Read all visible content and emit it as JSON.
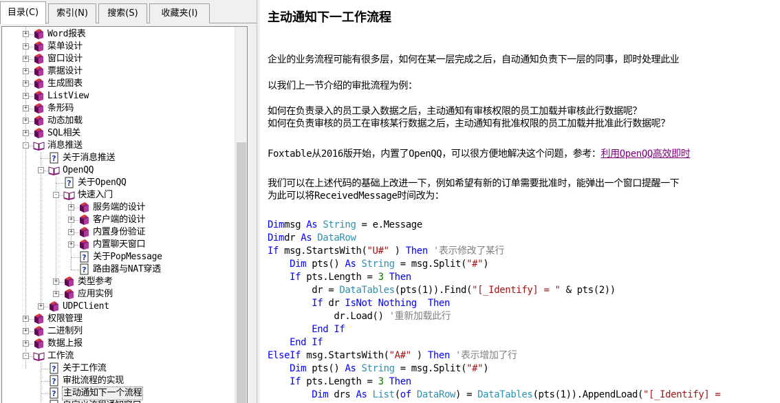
{
  "tabs": [
    "目录(C)",
    "索引(N)",
    "搜索(S)",
    "收藏夹(I)"
  ],
  "tree": [
    {
      "label": "Word报表",
      "depth": 0,
      "type": "book",
      "exp": "+"
    },
    {
      "label": "菜单设计",
      "depth": 0,
      "type": "book",
      "exp": "+"
    },
    {
      "label": "窗口设计",
      "depth": 0,
      "type": "book",
      "exp": "+"
    },
    {
      "label": "票据设计",
      "depth": 0,
      "type": "book",
      "exp": "+"
    },
    {
      "label": "生成图表",
      "depth": 0,
      "type": "book",
      "exp": "+"
    },
    {
      "label": "ListView",
      "depth": 0,
      "type": "book",
      "exp": "+"
    },
    {
      "label": "条形码",
      "depth": 0,
      "type": "book",
      "exp": "+"
    },
    {
      "label": "动态加载",
      "depth": 0,
      "type": "book",
      "exp": "+"
    },
    {
      "label": "SQL相关",
      "depth": 0,
      "type": "book",
      "exp": "+"
    },
    {
      "label": "消息推送",
      "depth": 0,
      "type": "open",
      "exp": "-"
    },
    {
      "label": "关于消息推送",
      "depth": 1,
      "type": "page",
      "exp": ""
    },
    {
      "label": "OpenQQ",
      "depth": 1,
      "type": "open",
      "exp": "-"
    },
    {
      "label": "关于OpenQQ",
      "depth": 2,
      "type": "page",
      "exp": ""
    },
    {
      "label": "快速入门",
      "depth": 2,
      "type": "open",
      "exp": "-"
    },
    {
      "label": "服务端的设计",
      "depth": 3,
      "type": "book",
      "exp": "+"
    },
    {
      "label": "客户端的设计",
      "depth": 3,
      "type": "book",
      "exp": "+"
    },
    {
      "label": "内置身份验证",
      "depth": 3,
      "type": "book",
      "exp": "+"
    },
    {
      "label": "内置聊天窗口",
      "depth": 3,
      "type": "book",
      "exp": "+"
    },
    {
      "label": "关于PopMessage",
      "depth": 3,
      "type": "page",
      "exp": ""
    },
    {
      "label": "路由器与NAT穿透",
      "depth": 3,
      "type": "page",
      "exp": ""
    },
    {
      "label": "类型参考",
      "depth": 2,
      "type": "book",
      "exp": "+"
    },
    {
      "label": "应用实例",
      "depth": 2,
      "type": "book",
      "exp": "+"
    },
    {
      "label": "UDPClient",
      "depth": 1,
      "type": "book",
      "exp": "+"
    },
    {
      "label": "权限管理",
      "depth": 0,
      "type": "book",
      "exp": "+"
    },
    {
      "label": "二进制列",
      "depth": 0,
      "type": "book",
      "exp": "+"
    },
    {
      "label": "数据上报",
      "depth": 0,
      "type": "book",
      "exp": "+"
    },
    {
      "label": "工作流",
      "depth": 0,
      "type": "open",
      "exp": "-"
    },
    {
      "label": "关于工作流",
      "depth": 1,
      "type": "page",
      "exp": ""
    },
    {
      "label": "审批流程的实现",
      "depth": 1,
      "type": "page",
      "exp": ""
    },
    {
      "label": "主动通知下一个流程",
      "depth": 1,
      "type": "page",
      "exp": "",
      "selected": true
    },
    {
      "label": "自定义流程通知窗口",
      "depth": 1,
      "type": "page",
      "exp": ""
    }
  ],
  "content": {
    "title": "主动通知下一工作流程",
    "p1": "企业的业务流程可能有很多层，如何在某一层完成之后，自动通知负责下一层的同事，即时处理此业",
    "p2": "以我们上一节介绍的审批流程为例：",
    "p3a": "如何在负责录入的员工录入数据之后，主动通知有审核权限的员工加载并审核此行数据呢？",
    "p3b": "如何在负责审核的员工在审核某行数据之后，主动通知有批准权限的员工加载并批准此行数据呢？",
    "p4": "Foxtable从2016版开始，内置了OpenQQ，可以很方便地解决这个问题，参考：",
    "p4link": "利用OpenQQ高效即时",
    "p5a": "我们可以在上述代码的基础上改进一下，例如希望有新的订单需要批准时，能弹出一个窗口提醒一下",
    "p5b": "为此可以将ReceivedMessage时间改为："
  },
  "code": [
    [
      [
        "kw",
        "Dim"
      ],
      [
        "",
        "msg "
      ],
      [
        "kw",
        "As "
      ],
      [
        "ty",
        "String"
      ],
      [
        "",
        " = e.Message"
      ]
    ],
    [
      [
        "kw",
        "Dim"
      ],
      [
        "",
        "dr "
      ],
      [
        "kw",
        "As "
      ],
      [
        "ty",
        "DataRow"
      ]
    ],
    [
      [
        "kw",
        "If "
      ],
      [
        "",
        "msg.StartsWith("
      ],
      [
        "str",
        "\"U#\""
      ],
      [
        "",
        " ) "
      ],
      [
        "kw",
        "Then "
      ],
      [
        "cm",
        "'表示修改了某行"
      ]
    ],
    [
      [
        "",
        "    "
      ],
      [
        "kw",
        "Dim "
      ],
      [
        "",
        "pts() "
      ],
      [
        "kw",
        "As "
      ],
      [
        "ty",
        "String"
      ],
      [
        "",
        " = msg.Split("
      ],
      [
        "str",
        "\"#\""
      ],
      [
        "",
        ")"
      ]
    ],
    [
      [
        "",
        "    "
      ],
      [
        "kw",
        "If "
      ],
      [
        "",
        "pts.Length = "
      ],
      [
        "num",
        "3 "
      ],
      [
        "kw",
        "Then"
      ]
    ],
    [
      [
        "",
        "        dr = "
      ],
      [
        "ty",
        "DataTables"
      ],
      [
        "",
        "(pts(1)).Find("
      ],
      [
        "str",
        "\"[_Identify] = \""
      ],
      [
        "",
        " & pts(2))"
      ]
    ],
    [
      [
        "",
        "        "
      ],
      [
        "kw",
        "If "
      ],
      [
        "",
        "dr "
      ],
      [
        "kw",
        "IsNot Nothing  Then"
      ]
    ],
    [
      [
        "",
        "            dr.Load() "
      ],
      [
        "cm",
        "'重新加载此行"
      ]
    ],
    [
      [
        "",
        "        "
      ],
      [
        "kw",
        "End If"
      ]
    ],
    [
      [
        "",
        "    "
      ],
      [
        "kw",
        "End If"
      ]
    ],
    [
      [
        "kw",
        "ElseIf "
      ],
      [
        "",
        "msg.StartsWith("
      ],
      [
        "str",
        "\"A#\""
      ],
      [
        "",
        " ) "
      ],
      [
        "kw",
        "Then "
      ],
      [
        "cm",
        "'表示增加了行"
      ]
    ],
    [
      [
        "",
        "    "
      ],
      [
        "kw",
        "Dim "
      ],
      [
        "",
        "pts() "
      ],
      [
        "kw",
        "As "
      ],
      [
        "ty",
        "String"
      ],
      [
        "",
        " = msg.Split("
      ],
      [
        "str",
        "\"#\""
      ],
      [
        "",
        ")"
      ]
    ],
    [
      [
        "",
        "    "
      ],
      [
        "kw",
        "If "
      ],
      [
        "",
        "pts.Length = "
      ],
      [
        "num",
        "3 "
      ],
      [
        "kw",
        "Then"
      ]
    ],
    [
      [
        "",
        "        "
      ],
      [
        "kw",
        "Dim "
      ],
      [
        "",
        "drs "
      ],
      [
        "kw",
        "As "
      ],
      [
        "ty",
        "List"
      ],
      [
        "",
        "("
      ],
      [
        "kw",
        "of "
      ],
      [
        "ty",
        "DataRow"
      ],
      [
        "",
        ") = "
      ],
      [
        "ty",
        "DataTables"
      ],
      [
        "",
        "(pts(1)).AppendLoad("
      ],
      [
        "str",
        "\"[_Identify] = "
      ]
    ]
  ],
  "colors": {
    "keyword": "#0000ff",
    "type": "#2b91af",
    "string": "#a31515",
    "comment": "#808080",
    "number": "#008000",
    "link": "#800080"
  },
  "icons": {
    "book": "closed-book-icon",
    "open": "open-book-icon",
    "page": "help-page-icon"
  }
}
